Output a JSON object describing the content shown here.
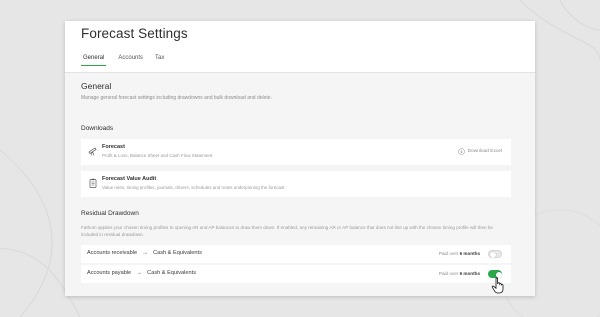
{
  "page": {
    "title": "Forecast Settings",
    "tabs": [
      {
        "label": "General",
        "active": true
      },
      {
        "label": "Accounts",
        "active": false
      },
      {
        "label": "Tax",
        "active": false
      }
    ]
  },
  "general": {
    "heading": "General",
    "description": "Manage general forecast settings including drawdowns and bulk download and delete."
  },
  "downloads": {
    "heading": "Downloads",
    "items": [
      {
        "icon": "telescope-icon",
        "title": "Forecast",
        "subtitle": "Profit & Loss, Balance Sheet and Cash Flow Statement",
        "action": "Download Excel"
      },
      {
        "icon": "clipboard-icon",
        "title": "Forecast Value Audit",
        "subtitle": "Value rules, timing profiles, journals, drivers, schedules and notes underpinning the forecast",
        "action": ""
      }
    ]
  },
  "residual": {
    "heading": "Residual Drawdown",
    "description": "Fathom applies your chosen timing profiles to opening AR and AP balances to draw them down. If enabled, any remaining AR or AP balance that does not line up with the chosen timing profile will then be included in residual drawdown.",
    "rows": [
      {
        "account": "Accounts receivable",
        "arrow": "→",
        "target": "Cash & Equivalents",
        "paid_label": "Paid over",
        "paid_value": "6 months",
        "enabled": false
      },
      {
        "account": "Accounts payable",
        "arrow": "→",
        "target": "Cash & Equivalents",
        "paid_label": "Paid over",
        "paid_value": "6 months",
        "enabled": true
      }
    ]
  },
  "colors": {
    "accent": "#2aa84a",
    "background": "#e6e6e6",
    "card": "#f5f5f5"
  }
}
